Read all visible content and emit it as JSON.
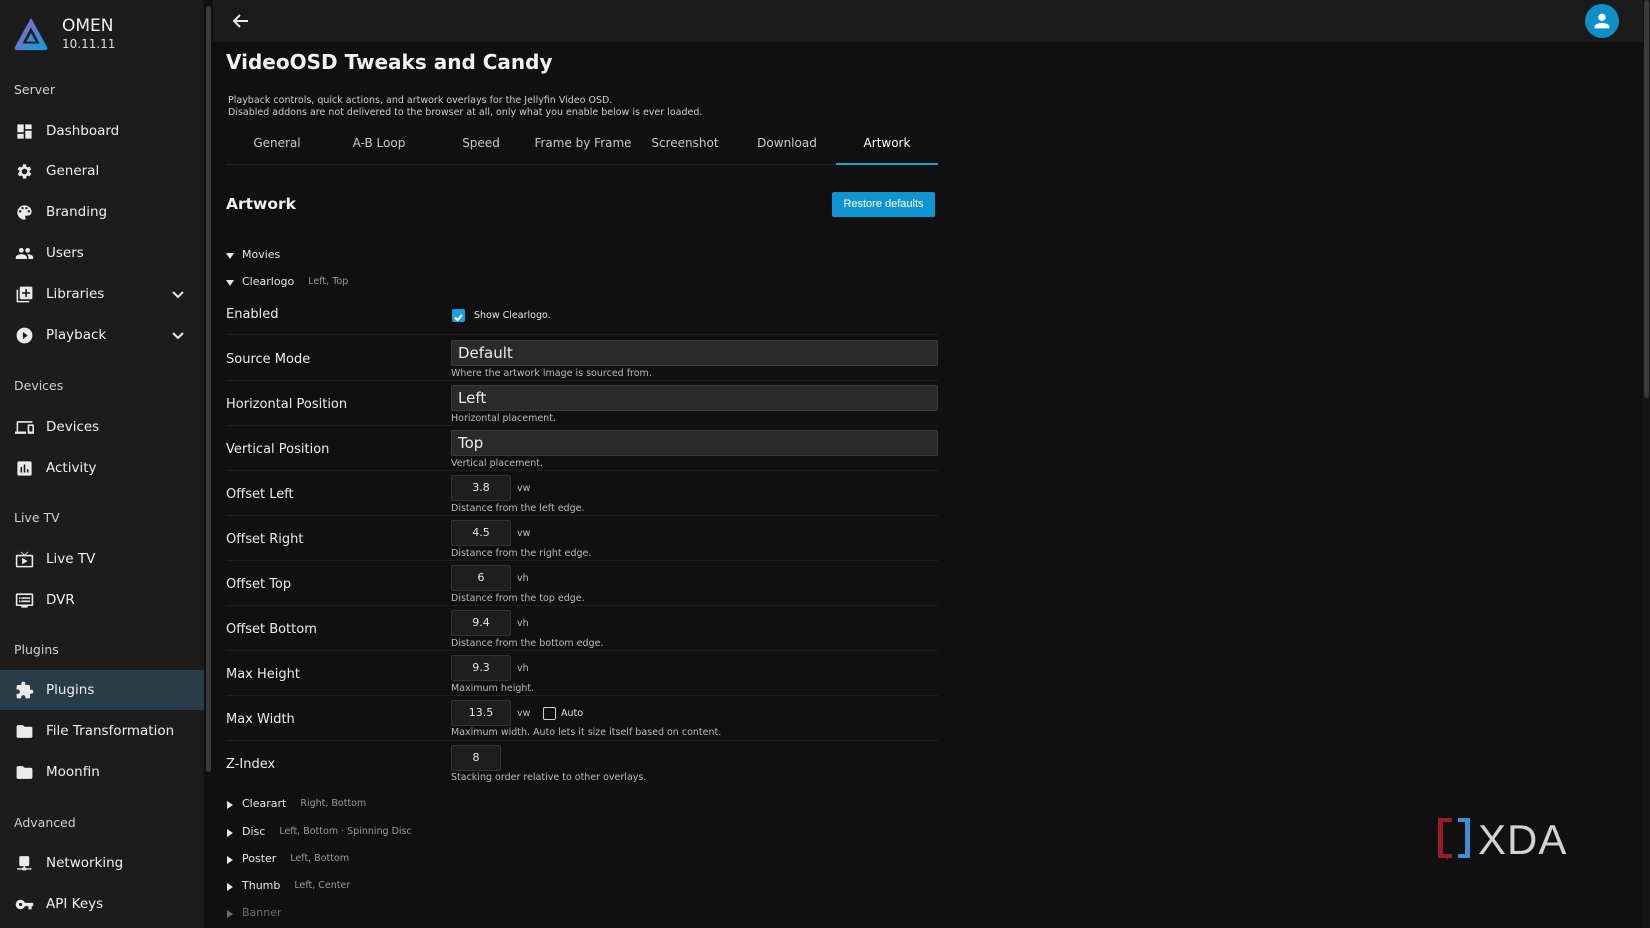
{
  "app": {
    "name": "OMEN",
    "version": "10.11.11"
  },
  "sidebar": {
    "sections": [
      {
        "title": "Server",
        "items": [
          {
            "label": "Dashboard",
            "icon": "dashboard-icon"
          },
          {
            "label": "General",
            "icon": "gear-icon"
          },
          {
            "label": "Branding",
            "icon": "palette-icon"
          },
          {
            "label": "Users",
            "icon": "users-icon"
          },
          {
            "label": "Libraries",
            "icon": "library-icon",
            "expandable": true
          },
          {
            "label": "Playback",
            "icon": "play-circle-icon",
            "expandable": true
          }
        ]
      },
      {
        "title": "Devices",
        "items": [
          {
            "label": "Devices",
            "icon": "devices-icon"
          },
          {
            "label": "Activity",
            "icon": "activity-icon"
          }
        ]
      },
      {
        "title": "Live TV",
        "items": [
          {
            "label": "Live TV",
            "icon": "live-tv-icon"
          },
          {
            "label": "DVR",
            "icon": "dvr-icon"
          }
        ]
      },
      {
        "title": "Plugins",
        "items": [
          {
            "label": "Plugins",
            "icon": "puzzle-icon",
            "active": true
          },
          {
            "label": "File Transformation",
            "icon": "folder-icon"
          },
          {
            "label": "Moonfin",
            "icon": "folder-icon"
          }
        ]
      },
      {
        "title": "Advanced",
        "items": [
          {
            "label": "Networking",
            "icon": "network-icon"
          },
          {
            "label": "API Keys",
            "icon": "key-icon"
          }
        ]
      }
    ]
  },
  "page": {
    "title": "VideoOSD Tweaks and Candy",
    "description_line1": "Playback controls, quick actions, and artwork overlays for the Jellyfin Video OSD.",
    "description_line2": "Disabled addons are not delivered to the browser at all, only what you enable below is ever loaded."
  },
  "tabs": [
    "General",
    "A-B Loop",
    "Speed",
    "Frame by Frame",
    "Screenshot",
    "Download",
    "Artwork"
  ],
  "active_tab": "Artwork",
  "artwork": {
    "section_title": "Artwork",
    "restore_label": "Restore defaults",
    "movies_label": "Movies",
    "clearlogo": {
      "label": "Clearlogo",
      "hint": "Left, Top"
    },
    "enabled": {
      "label": "Enabled",
      "checkbox_label": "Show Clearlogo.",
      "checked": true
    },
    "source_mode": {
      "label": "Source Mode",
      "value": "Default",
      "help": "Where the artwork image is sourced from."
    },
    "horizontal_position": {
      "label": "Horizontal Position",
      "value": "Left",
      "help": "Horizontal placement."
    },
    "vertical_position": {
      "label": "Vertical Position",
      "value": "Top",
      "help": "Vertical placement."
    },
    "offset_left": {
      "label": "Offset Left",
      "value": "3.8",
      "unit": "vw",
      "help": "Distance from the left edge."
    },
    "offset_right": {
      "label": "Offset Right",
      "value": "4.5",
      "unit": "vw",
      "help": "Distance from the right edge."
    },
    "offset_top": {
      "label": "Offset Top",
      "value": "6",
      "unit": "vh",
      "help": "Distance from the top edge."
    },
    "offset_bottom": {
      "label": "Offset Bottom",
      "value": "9.4",
      "unit": "vh",
      "help": "Distance from the bottom edge."
    },
    "max_height": {
      "label": "Max Height",
      "value": "9.3",
      "unit": "vh",
      "help": "Maximum height."
    },
    "max_width": {
      "label": "Max Width",
      "value": "13.5",
      "unit": "vw",
      "auto_label": "Auto",
      "auto_checked": false,
      "help": "Maximum width. Auto lets it size itself based on content."
    },
    "z_index": {
      "label": "Z-Index",
      "value": "8",
      "help": "Stacking order relative to other overlays."
    },
    "collapsed": [
      {
        "label": "Clearart",
        "hint": "Right, Bottom"
      },
      {
        "label": "Disc",
        "hint": "Left, Bottom · Spinning Disc"
      },
      {
        "label": "Poster",
        "hint": "Left, Bottom"
      },
      {
        "label": "Thumb",
        "hint": "Left, Center"
      },
      {
        "label": "Banner",
        "hint": ""
      }
    ]
  },
  "watermark": {
    "text": "XDA"
  }
}
